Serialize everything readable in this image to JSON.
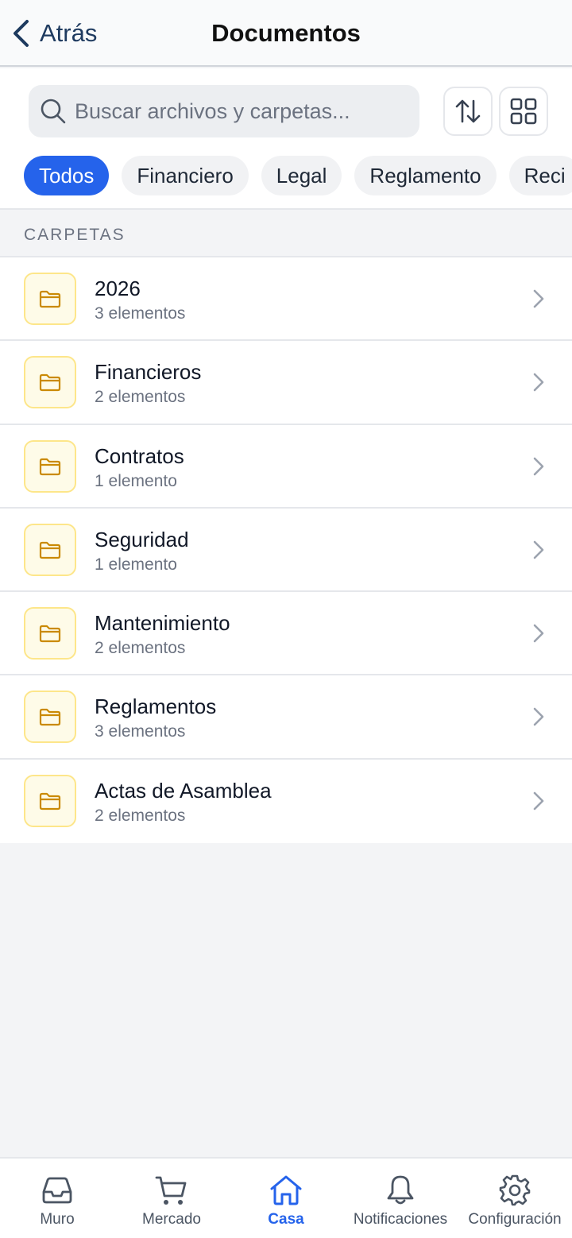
{
  "header": {
    "back_label": "Atrás",
    "title": "Documentos"
  },
  "search": {
    "placeholder": "Buscar archivos y carpetas..."
  },
  "filters": [
    {
      "label": "Todos",
      "active": true
    },
    {
      "label": "Financiero",
      "active": false
    },
    {
      "label": "Legal",
      "active": false
    },
    {
      "label": "Reglamento",
      "active": false
    },
    {
      "label": "Reci",
      "active": false
    }
  ],
  "section": {
    "label": "CARPETAS"
  },
  "folders": [
    {
      "name": "2026",
      "count": "3 elementos"
    },
    {
      "name": "Financieros",
      "count": "2 elementos"
    },
    {
      "name": "Contratos",
      "count": "1 elemento"
    },
    {
      "name": "Seguridad",
      "count": "1 elemento"
    },
    {
      "name": "Mantenimiento",
      "count": "2 elementos"
    },
    {
      "name": "Reglamentos",
      "count": "3 elementos"
    },
    {
      "name": "Actas de Asamblea",
      "count": "2 elementos"
    }
  ],
  "tabs": [
    {
      "label": "Muro",
      "icon": "inbox-icon",
      "active": false
    },
    {
      "label": "Mercado",
      "icon": "cart-icon",
      "active": false
    },
    {
      "label": "Casa",
      "icon": "home-icon",
      "active": true
    },
    {
      "label": "Notificaciones",
      "icon": "bell-icon",
      "active": false
    },
    {
      "label": "Configuración",
      "icon": "gear-icon",
      "active": false
    }
  ],
  "colors": {
    "accent": "#2563eb",
    "folder_icon": "#ca8a04",
    "folder_bg": "#fefbe8"
  }
}
